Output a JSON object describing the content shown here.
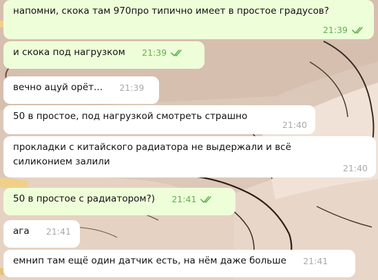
{
  "messages": [
    {
      "direction": "out",
      "text": "напомни, скока там 970про типично имеет в простое градусов?",
      "time": "21:39",
      "status": "read-double-check-icon"
    },
    {
      "direction": "out",
      "text": "и скока под нагрузком",
      "time": "21:39",
      "status": "read-double-check-icon"
    },
    {
      "direction": "in",
      "text": "вечно ацуй орёт...",
      "time": "21:39"
    },
    {
      "direction": "in",
      "text": "50 в простое, под нагрузкой смотреть страшно",
      "time": "21:40"
    },
    {
      "direction": "in",
      "text": "прокладки с китайского радиатора не выдержали и всё\nсиликонием залили",
      "time": "21:40"
    },
    {
      "direction": "out",
      "text": "50 в простое с радиатором?)",
      "time": "21:41",
      "status": "read-double-check-icon"
    },
    {
      "direction": "in",
      "text": "ага",
      "time": "21:41"
    },
    {
      "direction": "in",
      "text": "емнип там ещё один датчик есть, на нём даже больше",
      "time": "21:41"
    }
  ],
  "colors": {
    "outgoing_bubble": "#eefed9",
    "incoming_bubble": "#ffffff",
    "outgoing_time": "#5fb24f",
    "incoming_time": "#a9a9a9",
    "wallpaper": "#d9c4b3"
  }
}
